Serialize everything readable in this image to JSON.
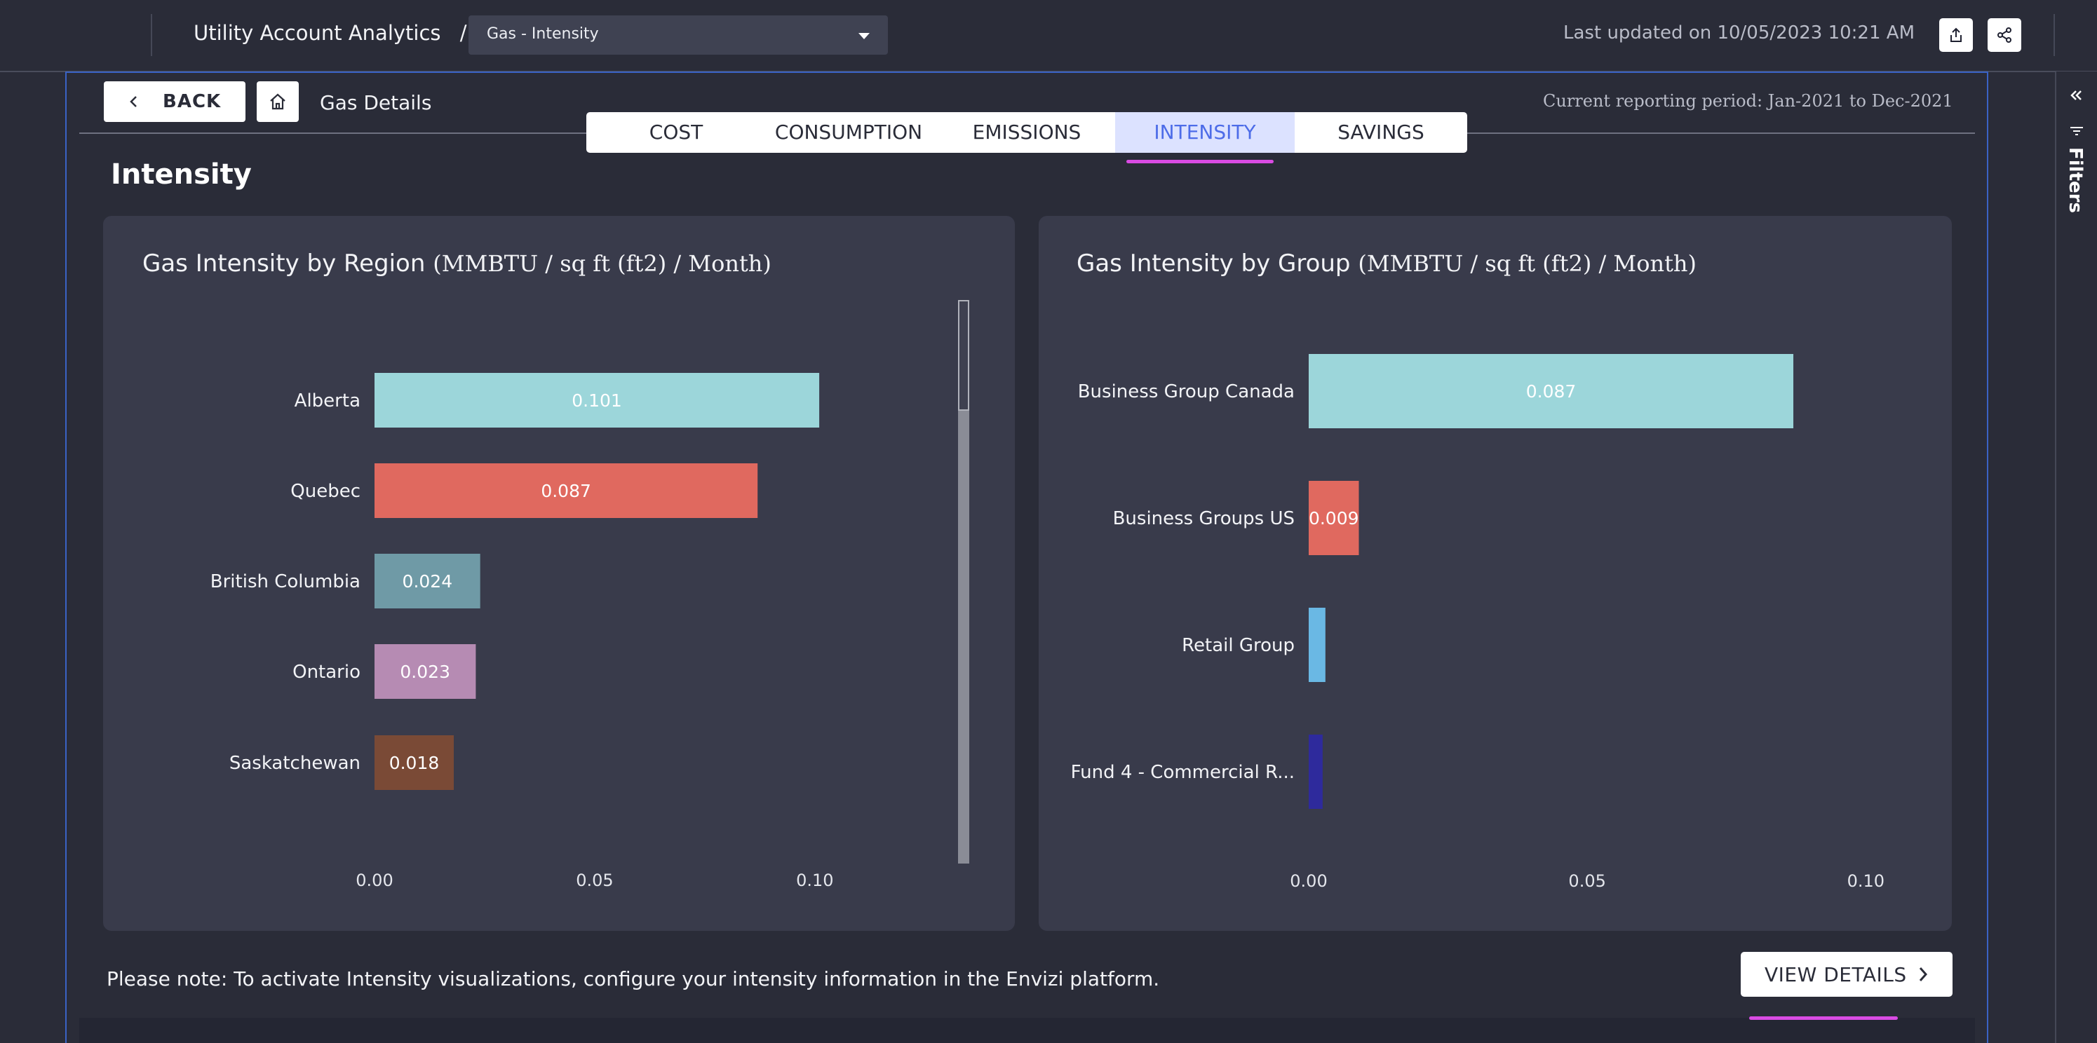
{
  "header": {
    "app_title": "Utility Account Analytics",
    "separator": "/",
    "view_select": "Gas - Intensity",
    "last_updated": "Last updated on 10/05/2023 10:21 AM"
  },
  "toolbar": {
    "back_label": "BACK",
    "breadcrumb": "Gas Details",
    "reporting_period": "Current reporting period: Jan-2021 to Dec-2021"
  },
  "tabs": [
    {
      "label": "COST"
    },
    {
      "label": "CONSUMPTION"
    },
    {
      "label": "EMISSIONS"
    },
    {
      "label": "INTENSITY",
      "active": true
    },
    {
      "label": "SAVINGS"
    }
  ],
  "section_title": "Intensity",
  "side_panel": {
    "label": "Filters"
  },
  "colors": {
    "teal": "#9cd6da",
    "coral": "#e0695f",
    "slate": "#6f9aa6",
    "mauve": "#b68bb3",
    "brown": "#7a4a36",
    "skyblue": "#6ab8e4",
    "indigo": "#2e2a9c",
    "accent": "#d94be3",
    "active_tab": "#4d6ce8"
  },
  "chart_data": [
    {
      "type": "bar",
      "orientation": "horizontal",
      "title": "Gas Intensity by Region",
      "unit": "(MMBTU / sq ft (ft2) / Month)",
      "categories": [
        "Alberta",
        "Quebec",
        "British Columbia",
        "Ontario",
        "Saskatchewan"
      ],
      "values": [
        0.101,
        0.087,
        0.024,
        0.023,
        0.018
      ],
      "labels": [
        "0.101",
        "0.087",
        "0.024",
        "0.023",
        "0.018"
      ],
      "colors": [
        "#9cd6da",
        "#e0695f",
        "#6f9aa6",
        "#b68bb3",
        "#7a4a36"
      ],
      "xlim": [
        0,
        0.115
      ],
      "xticks": [
        {
          "v": 0,
          "label": "0.00"
        },
        {
          "v": 0.05,
          "label": "0.05"
        },
        {
          "v": 0.1,
          "label": "0.10"
        }
      ],
      "grid": false,
      "scrollbar": true
    },
    {
      "type": "bar",
      "orientation": "horizontal",
      "title": "Gas Intensity by Group",
      "unit": "(MMBTU / sq ft (ft2) / Month)",
      "categories": [
        "Business Group Canada",
        "Business Groups US",
        "Retail Group",
        "Fund 4 - Commercial R..."
      ],
      "values": [
        0.087,
        0.009,
        0.003,
        0.0025
      ],
      "labels": [
        "0.087",
        "0.009",
        "",
        ""
      ],
      "colors": [
        "#9cd6da",
        "#e0695f",
        "#6ab8e4",
        "#2e2a9c"
      ],
      "xlim": [
        0,
        0.105
      ],
      "xticks": [
        {
          "v": 0,
          "label": "0.00"
        },
        {
          "v": 0.05,
          "label": "0.05"
        },
        {
          "v": 0.1,
          "label": "0.10"
        }
      ],
      "grid": false
    }
  ],
  "footer": {
    "note": "Please note: To activate Intensity visualizations, configure your intensity information in the Envizi platform.",
    "view_details_label": "VIEW DETAILS"
  }
}
